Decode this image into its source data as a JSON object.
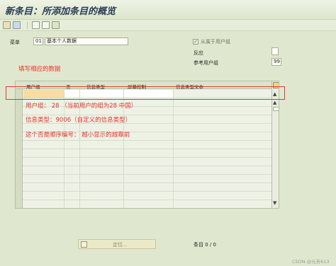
{
  "title": "新条目：所添加条目的概览",
  "menu": {
    "label": "菜单",
    "code": "01",
    "text": "基本个人数据"
  },
  "options": {
    "from_user_group_label": "从属于用户组",
    "from_user_group_mark": "✓",
    "reaction_label": "反应",
    "ref_user_group_label": "参考用户组",
    "ref_user_group_value": "99"
  },
  "annotations": {
    "fill_data": "填写相应的数据",
    "user_group": "用户组：  28  （当前用户的组为28    中国）",
    "info_type": "信息类型：9006（自定义的信息类型）",
    "no_order": "这个否是顺序编号：  越小显示的越靠前"
  },
  "table": {
    "columns": [
      "用户组",
      "否",
      "信息类型",
      "屏幕控制",
      "信息类型文本"
    ]
  },
  "scrollbar": {
    "up": "▲",
    "down": "▼"
  },
  "footer": {
    "locate_button": "定位...",
    "entry_status": "条目 0 / 0"
  },
  "watermark": "CSDN @元芳613",
  "colors": {
    "annotation": "#e8322c",
    "highlight_box": "#e23a2f"
  }
}
